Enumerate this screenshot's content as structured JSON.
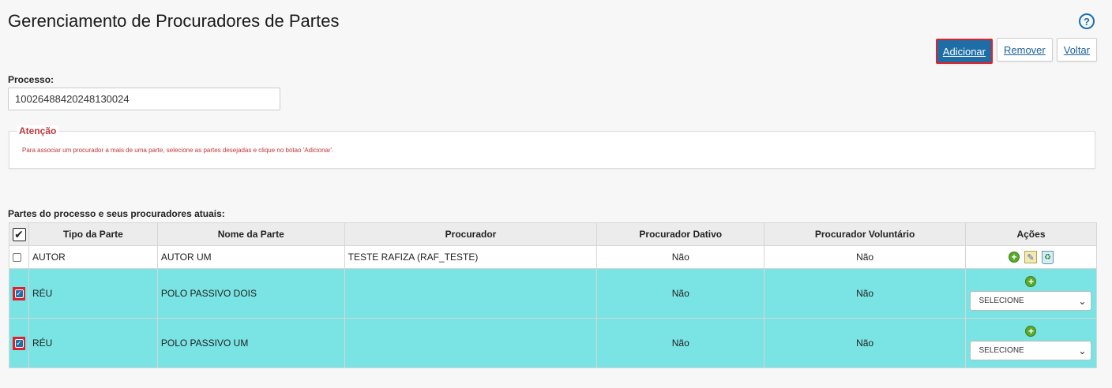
{
  "header": {
    "title": "Gerenciamento de Procuradores de Partes",
    "help_glyph": "?"
  },
  "toolbar": {
    "add_label": "Adicionar",
    "remove_label": "Remover",
    "back_label": "Voltar"
  },
  "processo": {
    "label": "Processo:",
    "value": "10026488420248130024"
  },
  "attention": {
    "legend": "Atenção",
    "text": "Para associar um procurador a mais de uma parte, selecione as partes desejadas e clique no botao 'Adicionar'."
  },
  "table": {
    "caption": "Partes do processo e seus procuradores atuais:",
    "header_checkbox": "✔",
    "columns": [
      "Tipo da Parte",
      "Nome da Parte",
      "Procurador",
      "Procurador Dativo",
      "Procurador Voluntário",
      "Ações"
    ],
    "rows": [
      {
        "tipo": "AUTOR",
        "nome": "AUTOR UM",
        "procurador": "TESTE RAFIZA (RAF_TESTE)",
        "dativo": "Não",
        "voluntario": "Não",
        "checked": false
      },
      {
        "tipo": "RÉU",
        "nome": "POLO PASSIVO DOIS",
        "procurador": "",
        "dativo": "Não",
        "voluntario": "Não",
        "checked": true,
        "select": "SELECIONE"
      },
      {
        "tipo": "RÉU",
        "nome": "POLO PASSIVO UM",
        "procurador": "",
        "dativo": "Não",
        "voluntario": "Não",
        "checked": true,
        "select": "SELECIONE"
      }
    ]
  },
  "colors": {
    "primary": "#1e6ea6",
    "alert": "#c3343a",
    "selected_row": "#7ae3e3"
  }
}
